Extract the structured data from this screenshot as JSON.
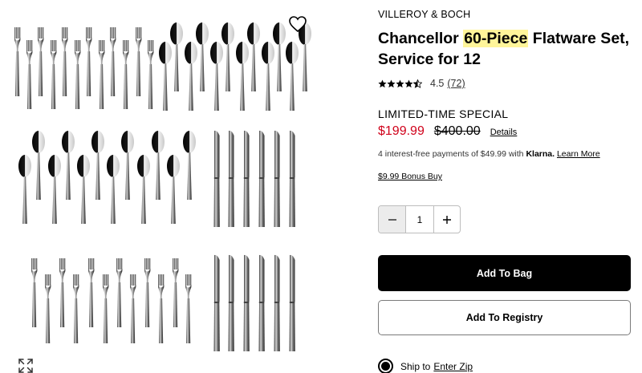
{
  "product": {
    "brand": "VILLEROY & BOCH",
    "title_before": "Chancellor ",
    "title_highlight": "60-Piece",
    "title_after": " Flatware Set, Service for 12",
    "rating_value": "4.5",
    "rating_count": "(72)",
    "rating_stars": 4.5
  },
  "pricing": {
    "special_label": "LIMITED-TIME SPECIAL",
    "sale_price": "$199.99",
    "original_price": "$400.00",
    "details_link": "Details",
    "installments_text": "4 interest-free payments of $49.99 with ",
    "installments_provider": "Klarna.",
    "installments_link": "Learn More",
    "bonus_link": "$9.99 Bonus Buy"
  },
  "quantity": {
    "value": "1"
  },
  "actions": {
    "add_to_bag": "Add To Bag",
    "add_to_registry": "Add To Registry"
  },
  "shipping": {
    "label": "Ship to",
    "zip_link": "Enter Zip"
  },
  "icons": {
    "wishlist": "heart-icon",
    "expand": "expand-icon",
    "minus": "minus-icon",
    "plus": "plus-icon",
    "star": "star-icon"
  },
  "colors": {
    "sale": "#d0021b",
    "highlight": "#fff59a",
    "primary_button": "#000000"
  }
}
